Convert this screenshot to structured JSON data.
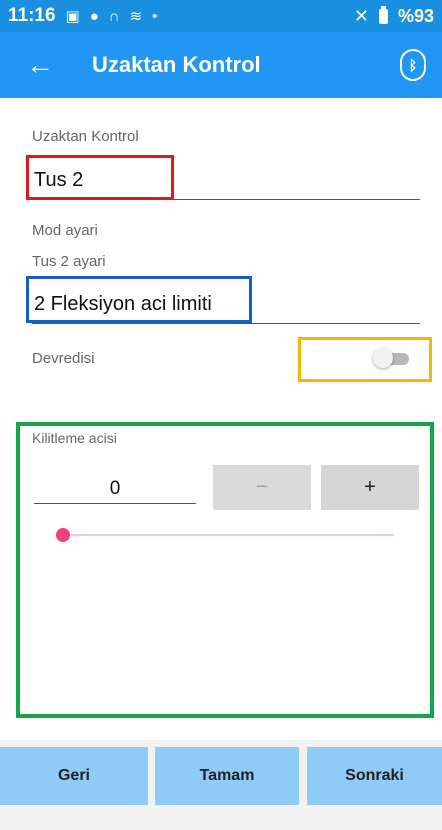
{
  "status_bar": {
    "time": "11:16",
    "battery_text": "%93"
  },
  "app_bar": {
    "title": "Uzaktan Kontrol"
  },
  "remote_control": {
    "label": "Uzaktan Kontrol",
    "value": "Tus 2"
  },
  "mode": {
    "label": "Mod ayari",
    "sub_label": "Tus 2 ayari",
    "value": "2 Fleksiyon aci limiti"
  },
  "disabled_toggle": {
    "label": "Devredisi",
    "checked": false
  },
  "lock_angle": {
    "label": "Kilitleme acisi",
    "value": "0",
    "minus_label": "−",
    "plus_label": "+",
    "slider_fraction": 0.0
  },
  "footer": {
    "back_label": "Geri",
    "ok_label": "Tamam",
    "next_label": "Sonraki"
  },
  "colors": {
    "accent": "#2196f3",
    "slider": "#f0407f",
    "button": "#8ecbf7"
  },
  "icons": {
    "back": "arrow-left-icon",
    "bluetooth": "bluetooth-icon"
  }
}
